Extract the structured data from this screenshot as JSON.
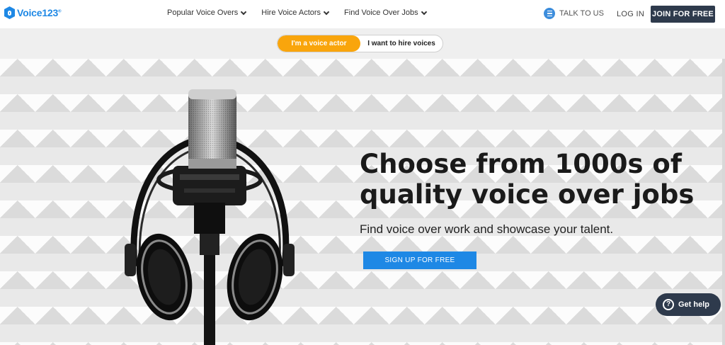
{
  "brand": {
    "name": "Voice123",
    "trademark": "®",
    "color": "#1e88e5"
  },
  "nav": {
    "items": [
      {
        "label": "Popular Voice Overs"
      },
      {
        "label": "Hire Voice Actors"
      },
      {
        "label": "Find Voice Over Jobs"
      }
    ]
  },
  "header": {
    "talk_label": "TALK TO US",
    "login_label": "LOG IN",
    "join_label": "JOIN FOR FREE"
  },
  "toggle": {
    "active_label": "I'm a voice actor",
    "inactive_label": "I want to hire voices",
    "active_color": "#f9a50c"
  },
  "hero": {
    "headline": "Choose from 1000s of quality voice over jobs",
    "subheadline": "Find voice over work and showcase your talent.",
    "cta_label": "SIGN UP FOR FREE",
    "cta_color": "#1e88e5"
  },
  "help": {
    "label": "Get help",
    "icon": "question-icon"
  },
  "icons": {
    "logo": "voice123-logo-icon",
    "talk": "chat-icon",
    "dropdown": "chevron-down-icon",
    "hero_image": "microphone-headphones-image"
  }
}
